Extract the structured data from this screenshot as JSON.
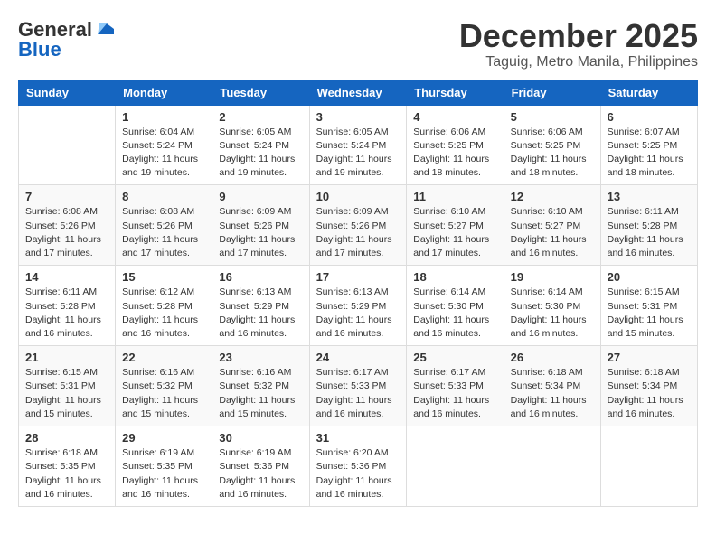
{
  "header": {
    "logo": {
      "line1": "General",
      "line2": "Blue"
    },
    "title": "December 2025",
    "location": "Taguig, Metro Manila, Philippines"
  },
  "weekdays": [
    "Sunday",
    "Monday",
    "Tuesday",
    "Wednesday",
    "Thursday",
    "Friday",
    "Saturday"
  ],
  "weeks": [
    [
      {
        "day": "",
        "info": ""
      },
      {
        "day": "1",
        "info": "Sunrise: 6:04 AM\nSunset: 5:24 PM\nDaylight: 11 hours\nand 19 minutes."
      },
      {
        "day": "2",
        "info": "Sunrise: 6:05 AM\nSunset: 5:24 PM\nDaylight: 11 hours\nand 19 minutes."
      },
      {
        "day": "3",
        "info": "Sunrise: 6:05 AM\nSunset: 5:24 PM\nDaylight: 11 hours\nand 19 minutes."
      },
      {
        "day": "4",
        "info": "Sunrise: 6:06 AM\nSunset: 5:25 PM\nDaylight: 11 hours\nand 18 minutes."
      },
      {
        "day": "5",
        "info": "Sunrise: 6:06 AM\nSunset: 5:25 PM\nDaylight: 11 hours\nand 18 minutes."
      },
      {
        "day": "6",
        "info": "Sunrise: 6:07 AM\nSunset: 5:25 PM\nDaylight: 11 hours\nand 18 minutes."
      }
    ],
    [
      {
        "day": "7",
        "info": "Sunrise: 6:08 AM\nSunset: 5:26 PM\nDaylight: 11 hours\nand 17 minutes."
      },
      {
        "day": "8",
        "info": "Sunrise: 6:08 AM\nSunset: 5:26 PM\nDaylight: 11 hours\nand 17 minutes."
      },
      {
        "day": "9",
        "info": "Sunrise: 6:09 AM\nSunset: 5:26 PM\nDaylight: 11 hours\nand 17 minutes."
      },
      {
        "day": "10",
        "info": "Sunrise: 6:09 AM\nSunset: 5:26 PM\nDaylight: 11 hours\nand 17 minutes."
      },
      {
        "day": "11",
        "info": "Sunrise: 6:10 AM\nSunset: 5:27 PM\nDaylight: 11 hours\nand 17 minutes."
      },
      {
        "day": "12",
        "info": "Sunrise: 6:10 AM\nSunset: 5:27 PM\nDaylight: 11 hours\nand 16 minutes."
      },
      {
        "day": "13",
        "info": "Sunrise: 6:11 AM\nSunset: 5:28 PM\nDaylight: 11 hours\nand 16 minutes."
      }
    ],
    [
      {
        "day": "14",
        "info": "Sunrise: 6:11 AM\nSunset: 5:28 PM\nDaylight: 11 hours\nand 16 minutes."
      },
      {
        "day": "15",
        "info": "Sunrise: 6:12 AM\nSunset: 5:28 PM\nDaylight: 11 hours\nand 16 minutes."
      },
      {
        "day": "16",
        "info": "Sunrise: 6:13 AM\nSunset: 5:29 PM\nDaylight: 11 hours\nand 16 minutes."
      },
      {
        "day": "17",
        "info": "Sunrise: 6:13 AM\nSunset: 5:29 PM\nDaylight: 11 hours\nand 16 minutes."
      },
      {
        "day": "18",
        "info": "Sunrise: 6:14 AM\nSunset: 5:30 PM\nDaylight: 11 hours\nand 16 minutes."
      },
      {
        "day": "19",
        "info": "Sunrise: 6:14 AM\nSunset: 5:30 PM\nDaylight: 11 hours\nand 16 minutes."
      },
      {
        "day": "20",
        "info": "Sunrise: 6:15 AM\nSunset: 5:31 PM\nDaylight: 11 hours\nand 15 minutes."
      }
    ],
    [
      {
        "day": "21",
        "info": "Sunrise: 6:15 AM\nSunset: 5:31 PM\nDaylight: 11 hours\nand 15 minutes."
      },
      {
        "day": "22",
        "info": "Sunrise: 6:16 AM\nSunset: 5:32 PM\nDaylight: 11 hours\nand 15 minutes."
      },
      {
        "day": "23",
        "info": "Sunrise: 6:16 AM\nSunset: 5:32 PM\nDaylight: 11 hours\nand 15 minutes."
      },
      {
        "day": "24",
        "info": "Sunrise: 6:17 AM\nSunset: 5:33 PM\nDaylight: 11 hours\nand 16 minutes."
      },
      {
        "day": "25",
        "info": "Sunrise: 6:17 AM\nSunset: 5:33 PM\nDaylight: 11 hours\nand 16 minutes."
      },
      {
        "day": "26",
        "info": "Sunrise: 6:18 AM\nSunset: 5:34 PM\nDaylight: 11 hours\nand 16 minutes."
      },
      {
        "day": "27",
        "info": "Sunrise: 6:18 AM\nSunset: 5:34 PM\nDaylight: 11 hours\nand 16 minutes."
      }
    ],
    [
      {
        "day": "28",
        "info": "Sunrise: 6:18 AM\nSunset: 5:35 PM\nDaylight: 11 hours\nand 16 minutes."
      },
      {
        "day": "29",
        "info": "Sunrise: 6:19 AM\nSunset: 5:35 PM\nDaylight: 11 hours\nand 16 minutes."
      },
      {
        "day": "30",
        "info": "Sunrise: 6:19 AM\nSunset: 5:36 PM\nDaylight: 11 hours\nand 16 minutes."
      },
      {
        "day": "31",
        "info": "Sunrise: 6:20 AM\nSunset: 5:36 PM\nDaylight: 11 hours\nand 16 minutes."
      },
      {
        "day": "",
        "info": ""
      },
      {
        "day": "",
        "info": ""
      },
      {
        "day": "",
        "info": ""
      }
    ]
  ]
}
